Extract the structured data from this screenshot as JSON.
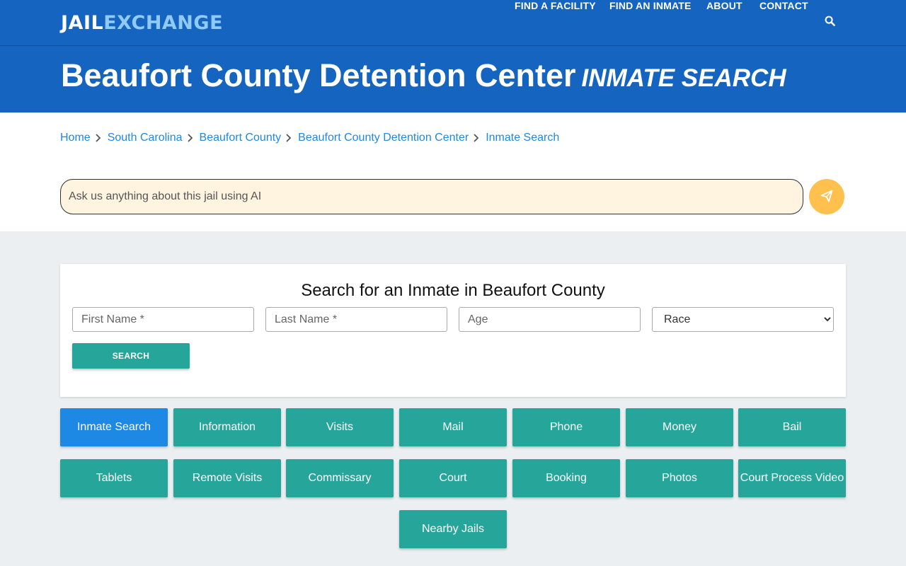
{
  "header": {
    "logo_part1": "JAIL",
    "logo_part2": "EXCHANGE",
    "nav": [
      "FIND A FACILITY",
      "FIND AN INMATE",
      "ABOUT",
      "CONTACT"
    ],
    "search_icon": "search-icon"
  },
  "title": {
    "main": "Beaufort County Detention Center",
    "sub": "INMATE SEARCH"
  },
  "breadcrumb": [
    "Home",
    "South Carolina",
    "Beaufort County",
    "Beaufort County Detention Center",
    "Inmate Search"
  ],
  "ai": {
    "placeholder": "Ask us anything about this jail using AI",
    "send_icon": "paper-plane-icon"
  },
  "search_form": {
    "title": "Search for an Inmate in Beaufort County",
    "first_name_placeholder": "First Name *",
    "last_name_placeholder": "Last Name *",
    "age_placeholder": "Age",
    "race_selected": "Race",
    "button": "SEARCH"
  },
  "tiles": [
    "Inmate Search",
    "Information",
    "Visits",
    "Mail",
    "Phone",
    "Money",
    "Bail",
    "Tablets",
    "Remote Visits",
    "Commissary",
    "Court",
    "Booking",
    "Photos",
    "Court Process Video",
    "Nearby Jails"
  ],
  "active_tile": "Inmate Search",
  "colors": {
    "brand_blue": "#1565c0",
    "link_blue": "#1e88e5",
    "teal": "#26a69a",
    "send_yellow": "#ffc04d",
    "ai_input_bg": "#fff4e0"
  }
}
